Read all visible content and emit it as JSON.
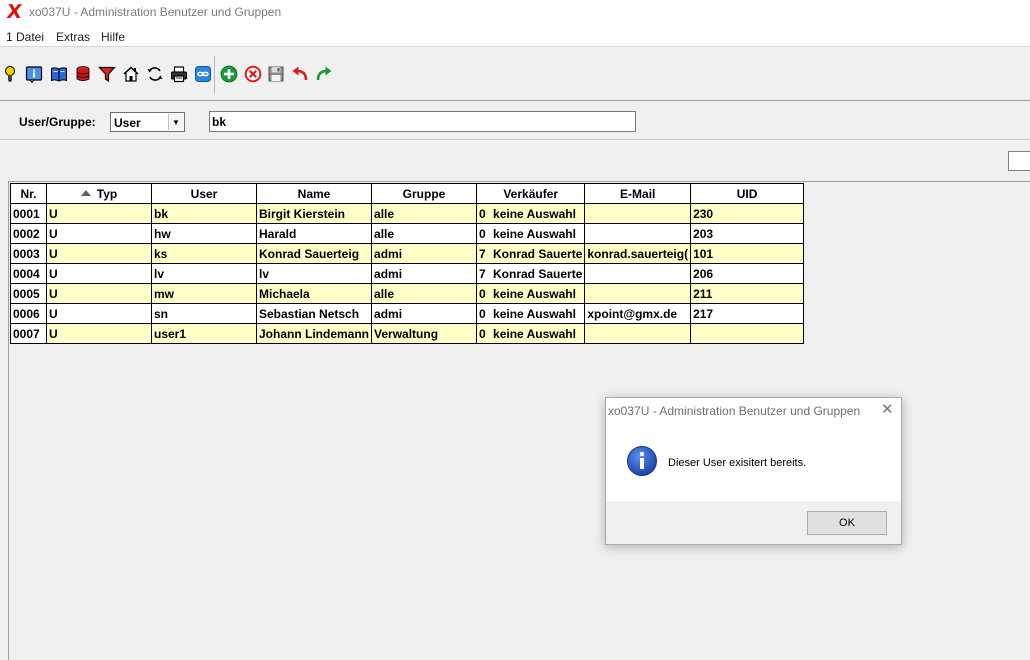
{
  "window": {
    "logo_text": "X",
    "title": "xo037U - Administration Benutzer und Gruppen"
  },
  "menu": {
    "items": [
      "1 Datei",
      "Extras",
      "Hilfe"
    ]
  },
  "toolbar": {
    "buttons": [
      "lightbulb-icon",
      "info-icon",
      "book-icon",
      "database-icon",
      "filter-icon",
      "home-icon",
      "refresh-icon",
      "print-icon",
      "link-icon",
      "add-icon",
      "delete-icon",
      "save-icon",
      "undo-icon",
      "redo-icon"
    ]
  },
  "filter": {
    "label": "User/Gruppe:",
    "type_value": "User",
    "search_value": "bk"
  },
  "table": {
    "headers": [
      "Nr.",
      "Typ",
      "User",
      "Name",
      "Gruppe",
      "Verkäufer",
      "E-Mail",
      "UID"
    ],
    "rows": [
      {
        "nr": "0001",
        "typ": "U",
        "user": "bk",
        "name": "Birgit Kierstein",
        "gruppe": "alle",
        "vk_nr": "0",
        "vk_name": "keine Auswahl",
        "email": "",
        "uid": "230"
      },
      {
        "nr": "0002",
        "typ": "U",
        "user": "hw",
        "name": "Harald",
        "gruppe": "alle",
        "vk_nr": "0",
        "vk_name": "keine Auswahl",
        "email": "",
        "uid": "203"
      },
      {
        "nr": "0003",
        "typ": "U",
        "user": "ks",
        "name": "Konrad Sauerteig",
        "gruppe": "admi",
        "vk_nr": "7",
        "vk_name": "Konrad Sauerte",
        "email": "konrad.sauerteig(",
        "uid": "101"
      },
      {
        "nr": "0004",
        "typ": "U",
        "user": "lv",
        "name": "lv",
        "gruppe": "admi",
        "vk_nr": "7",
        "vk_name": "Konrad Sauerte",
        "email": "",
        "uid": "206"
      },
      {
        "nr": "0005",
        "typ": "U",
        "user": "mw",
        "name": "Michaela",
        "gruppe": "alle",
        "vk_nr": "0",
        "vk_name": "keine Auswahl",
        "email": "",
        "uid": "211"
      },
      {
        "nr": "0006",
        "typ": "U",
        "user": "sn",
        "name": "Sebastian Netsch",
        "gruppe": "admi",
        "vk_nr": "0",
        "vk_name": "keine Auswahl",
        "email": "xpoint@gmx.de",
        "uid": "217"
      },
      {
        "nr": "0007",
        "typ": "U",
        "user": "user1",
        "name": "Johann Lindemann",
        "gruppe": "Verwaltung",
        "vk_nr": "0",
        "vk_name": "keine Auswahl",
        "email": "",
        "uid": ""
      }
    ]
  },
  "dialog": {
    "title": "xo037U - Administration Benutzer und Gruppen",
    "icon": "info-icon",
    "message": "Dieser User exisitert bereits.",
    "ok_label": "OK"
  },
  "colors": {
    "row_highlight": "#ffffc8",
    "logo": "#e01010",
    "info_blue": "#1f4fb8"
  }
}
